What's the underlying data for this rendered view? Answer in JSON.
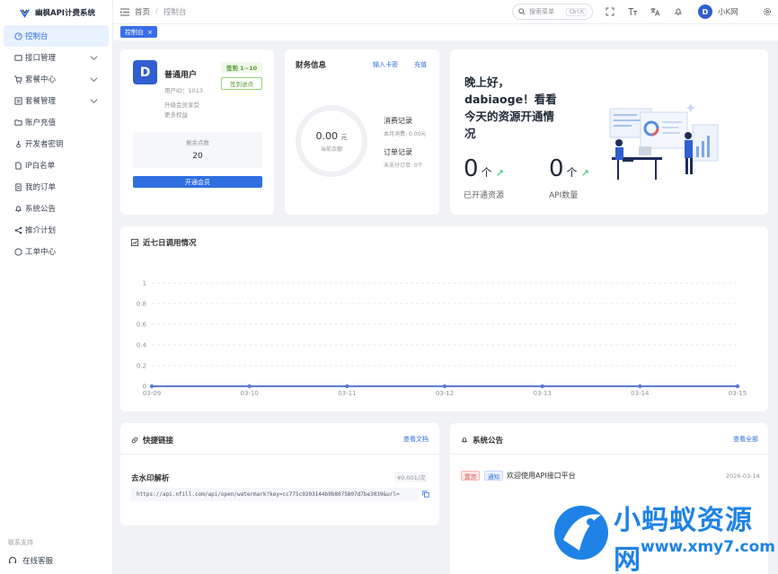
{
  "app": {
    "title": "幽枫API计费系统"
  },
  "colors": {
    "primary": "#2f6fe0",
    "success": "#529b2e",
    "danger": "#e05252",
    "watermark": "#1e82e6"
  },
  "sidebar": {
    "items": [
      {
        "label": "控制台",
        "icon": "dashboard-icon"
      },
      {
        "label": "接口管理",
        "icon": "interface-icon"
      },
      {
        "label": "套餐中心",
        "icon": "cart-icon"
      },
      {
        "label": "套餐管理",
        "icon": "list-icon"
      },
      {
        "label": "账户充值",
        "icon": "folder-icon"
      },
      {
        "label": "开发者密钥",
        "icon": "key-icon"
      },
      {
        "label": "IP白名单",
        "icon": "document-icon"
      },
      {
        "label": "我的订单",
        "icon": "order-icon"
      },
      {
        "label": "系统公告",
        "icon": "bell-icon"
      },
      {
        "label": "推介计划",
        "icon": "share-icon"
      },
      {
        "label": "工单中心",
        "icon": "chat-icon"
      }
    ],
    "footer_label": "联系支持",
    "footer_item": "在线客服"
  },
  "topbar": {
    "breadcrumb_home": "首页",
    "breadcrumb_current": "控制台",
    "search_placeholder": "搜索菜单",
    "search_shortcut": "Ctrl K",
    "user_initial": "D",
    "user_name": "小K网"
  },
  "tabs": [
    {
      "label": "控制台"
    }
  ],
  "user_card": {
    "avatar": "D",
    "name": "普通用户",
    "user_id": "用户ID：1013",
    "hint_line1": "升级会员享受",
    "hint_line2": "更多权益",
    "sign_badge": "签到 1~10",
    "sign_button": "签到送点",
    "balance_label": "剩余点数",
    "balance_value": "20",
    "open_vip": "开通会员"
  },
  "finance": {
    "title": "财务信息",
    "link_card": "输入卡密",
    "link_recharge": "充值",
    "balance": "0.00",
    "unit": "元",
    "balance_label": "当前余额",
    "consume_title": "消费记录",
    "consume_sub": "本月消费: 0.00元",
    "order_title": "订单记录",
    "order_sub": "未支付订单: 0个"
  },
  "welcome": {
    "greeting": "晚上好，dabiaoge！看看今天的资源开通情况",
    "stat1_value": "0",
    "stat1_unit": "个",
    "stat1_label": "已开通资源",
    "stat2_value": "0",
    "stat2_unit": "个",
    "stat2_label": "API数量"
  },
  "usage_chart": {
    "title": "近七日调用情况"
  },
  "chart_data": {
    "type": "line",
    "x": [
      "03-09",
      "03-10",
      "03-11",
      "03-12",
      "03-13",
      "03-14",
      "03-15"
    ],
    "series": [
      {
        "values": [
          0,
          0,
          0,
          0,
          0,
          0,
          0
        ]
      }
    ],
    "ylim": [
      0,
      1
    ],
    "yticks": [
      "0",
      "0.2",
      "0.4",
      "0.6",
      "0.8",
      "1"
    ],
    "grid": true,
    "color": "#5b7bd5"
  },
  "quick_links": {
    "title": "快捷链接",
    "view_docs": "查看文档",
    "item_name": "去水印解析",
    "item_price": "¥0.001/次",
    "item_url": "https://api.nfill.com/api/open/watermark?key=cc775c0203144b9b8075807d7be3039&url="
  },
  "announcements": {
    "title": "系统公告",
    "view_all": "查看全部",
    "items": [
      {
        "tag1": "置顶",
        "tag2": "通知",
        "text": "欢迎使用API接口平台",
        "date": "2026-03-14"
      }
    ]
  },
  "watermark": {
    "main": "小蚂蚁资源网",
    "sub": "www.xmy7.com"
  }
}
